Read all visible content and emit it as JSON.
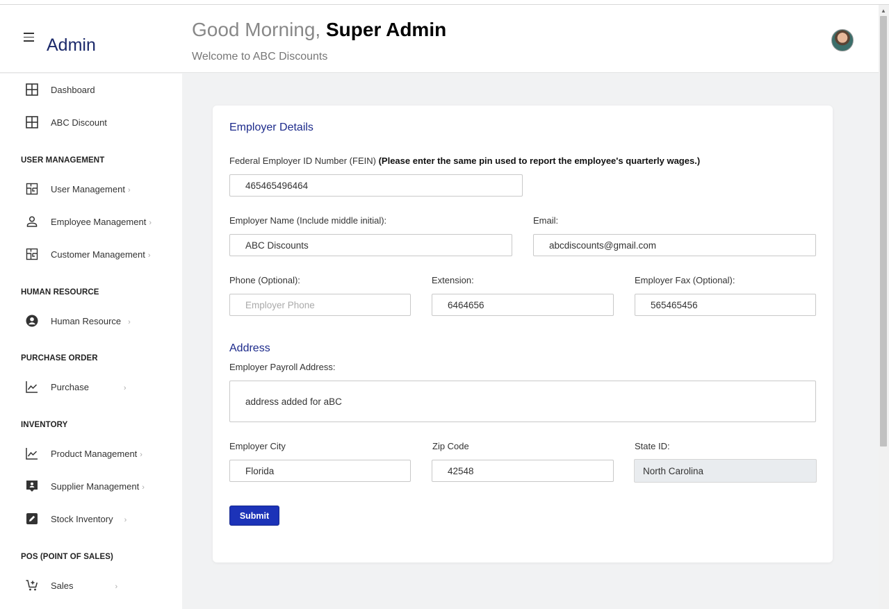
{
  "header": {
    "brand": "Admin",
    "greeting_prefix": "Good Morning,",
    "greeting_name": "Super Admin",
    "welcome": "Welcome to ABC Discounts"
  },
  "sidebar": {
    "items": [
      {
        "label": "Dashboard",
        "icon": "grid-icon"
      },
      {
        "label": "ABC Discount",
        "icon": "grid-icon"
      }
    ],
    "sections": [
      {
        "title": "USER MANAGEMENT",
        "items": [
          {
            "label": "User Management",
            "icon": "floorplan-icon",
            "chevron": "›"
          },
          {
            "label": "Employee Management",
            "icon": "person-icon",
            "chevron": "›"
          },
          {
            "label": "Customer Management",
            "icon": "floorplan-icon",
            "chevron": "›"
          }
        ]
      },
      {
        "title": "HUMAN RESOURCE",
        "items": [
          {
            "label": "Human Resource",
            "icon": "user-circle-icon",
            "chevron": "›"
          }
        ]
      },
      {
        "title": "PURCHASE ORDER",
        "items": [
          {
            "label": "Purchase",
            "icon": "line-chart-icon",
            "chevron": "›"
          }
        ]
      },
      {
        "title": "INVENTORY",
        "items": [
          {
            "label": "Product Management",
            "icon": "line-chart-icon",
            "chevron": "›"
          },
          {
            "label": "Supplier Management",
            "icon": "contact-badge-icon",
            "chevron": "›"
          },
          {
            "label": "Stock Inventory",
            "icon": "edit-box-icon",
            "chevron": "›"
          }
        ]
      },
      {
        "title": "POS (POINT OF SALES)",
        "items": [
          {
            "label": "Sales",
            "icon": "cart-add-icon",
            "chevron": "›"
          }
        ]
      }
    ]
  },
  "form": {
    "title": "Employer Details",
    "fein_label": "Federal Employer ID Number (FEIN)",
    "fein_note": "(Please enter the same pin used to report the employee's quarterly wages.)",
    "fein_value": "465465496464",
    "name_label": "Employer Name (Include middle initial):",
    "name_value": "ABC Discounts",
    "email_label": "Email:",
    "email_value": "abcdiscounts@gmail.com",
    "phone_label": "Phone (Optional):",
    "phone_placeholder": "Employer Phone",
    "phone_value": "",
    "extension_label": "Extension:",
    "extension_value": "6464656",
    "fax_label": "Employer Fax (Optional):",
    "fax_value": "565465456",
    "address_title": "Address",
    "address_label": "Employer Payroll Address:",
    "address_value": "address added for aBC",
    "city_label": "Employer City",
    "city_value": "Florida",
    "zip_label": "Zip Code",
    "zip_value": "42548",
    "state_label": "State ID:",
    "state_value": "North Carolina",
    "submit_label": "Submit"
  },
  "colors": {
    "accent": "#1c33b8",
    "heading": "#1c2a8b",
    "background": "#f1f2f3"
  }
}
